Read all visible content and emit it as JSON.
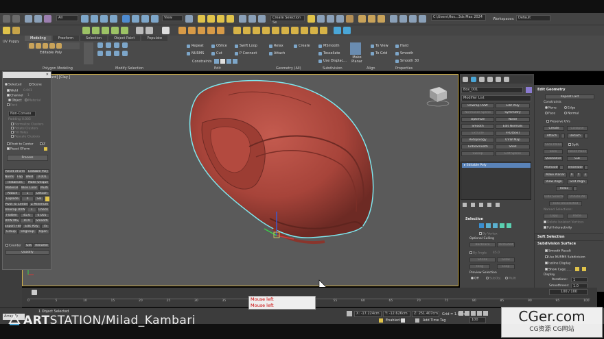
{
  "menubar": {
    "uv_puppy": "UV Puppy"
  },
  "toolbar": {
    "all_filter": "All",
    "view_select": "View",
    "selection_set": "Create Selection Se",
    "workspace_path": "C:\\Users\\Hos...3ds Max 2024",
    "workspace": "Default"
  },
  "ribbon": {
    "tabs": [
      "Modeling",
      "Freeform",
      "Selection",
      "Object Paint",
      "Populate"
    ],
    "active_tab": "Modeling",
    "object_type": "Editable Poly",
    "sections": [
      "Polygon Modeling",
      "Modify Selection",
      "Edit",
      "Geometry (All)",
      "Subdivision",
      "Align",
      "Properties"
    ],
    "edit_buttons": [
      "Repeat",
      "QSlice",
      "Swift Loop",
      "NURMS",
      "Cut",
      "P Connect",
      "Constraints"
    ],
    "geometry_buttons": [
      "Relax",
      "Create",
      "Attach"
    ],
    "subdivision_buttons": [
      "MSmooth",
      "Tessellate",
      "Use Displac..."
    ],
    "align_buttons": [
      "Make Planar",
      "To View",
      "To Grid"
    ],
    "properties_buttons": [
      "Hard",
      "Smooth",
      "Smooth 30"
    ]
  },
  "viewport": {
    "label": "[+] [Standard] [Clay ]"
  },
  "float_panel": {
    "selected": "Selected",
    "scene": "Scene",
    "weld": "Weld",
    "weld_val": "0.001",
    "channel": "Channel",
    "channel_val": "1",
    "object": "Object",
    "material": "Material",
    "pack": "Pack",
    "non_convex": "Non-Convex",
    "padding": "Padding",
    "padding_val": "0.005",
    "normalize": "Normalize Clusters",
    "rotate": "Rotate Clusters",
    "fill_holes": "Fill Holes",
    "rescale": "Rescale Clusters",
    "pivot_center": "Pivot to Center",
    "z_label": "Z",
    "reset_xform": "Reset XForm",
    "process": "Process",
    "rows": [
      [
        "Reset XForm",
        "Editable Poly"
      ],
      [
        "Normal",
        "Flip",
        "Weld",
        "0.001"
      ],
      [
        "Instances",
        "Make Unique"
      ],
      [
        "Material",
        "Wire Color",
        "Multi"
      ],
      [
        "Attach",
        "1",
        "Detach"
      ],
      [
        "Explode",
        "0",
        "Sel"
      ],
      [
        "Pivot To Center",
        "Z Minimum"
      ],
      [
        "Unwrap UVW",
        "1",
        "Check"
      ],
      [
        "Flatten",
        "45.0",
        "0.005"
      ],
      [
        "UVW Map",
        "10.0",
        "Smooth"
      ],
      [
        "Export FBX",
        "Edit Poly",
        "TS"
      ],
      [
        "Group",
        "Ungroup",
        "Open"
      ]
    ],
    "counter": "Counter",
    "get": "Get",
    "rename": "Rename",
    "quadify": "Quadify"
  },
  "command_panel": {
    "object_name": "Box_001",
    "modifier_list": "Modifier List",
    "modifiers": [
      "Unwrap UVW",
      "Edit Poly",
      "Normalize Spline",
      "Symmetry",
      "Optimize",
      "Noise",
      "Smooth",
      "Edit Normals",
      "Extrude",
      "FFD(box)",
      "Retopology",
      "UVW Map",
      "TurboSmooth",
      "Shell",
      "Sweep",
      "Edit Spline"
    ],
    "stack_item": "Editable Poly",
    "selection_header": "Selection",
    "by_vertex": "By Vertex",
    "optional_culling": "Optional Culling",
    "backface": "BackFace",
    "occluded": "Occluded",
    "by_angle": "By Angle",
    "angle_val": "45.0",
    "shrink": "Shrink",
    "grow": "Grow",
    "ring": "Ring",
    "loop": "Loop",
    "preview_selection": "Preview Selection",
    "off": "Off",
    "subobj": "SubObj",
    "multi": "Multi",
    "info": "1 Object Selected"
  },
  "edit_geometry": {
    "header": "Edit Geometry",
    "repeat_last": "Repeat Last",
    "constraints": "Constraints",
    "none": "None",
    "edge": "Edge",
    "face": "Face",
    "normal": "Normal",
    "preserve_uvs": "Preserve UVs",
    "create": "Create",
    "collapse": "Collapse",
    "attach": "Attach",
    "detach": "Detach",
    "slice_plane": "Slice Plane",
    "split": "Split",
    "slice": "Slice",
    "reset_plane": "Reset Plane",
    "quickslice": "QuickSlice",
    "cut": "Cut",
    "msmooth": "MSmooth",
    "tessellate": "Tessellate",
    "make_planar": "Make Planar",
    "x": "X",
    "y": "Y",
    "z": "Z",
    "view_align": "View Align",
    "grid_align": "Grid Align",
    "relax": "Relax",
    "hide_selected": "Hide Selected",
    "unhide_all": "Unhide All",
    "hide_unselected": "Hide Unselected",
    "named_selections": "Named Selections:",
    "copy": "Copy",
    "paste": "Paste",
    "delete_isolated": "Delete Isolated Vertices",
    "full_interactivity": "Full Interactivity",
    "soft_selection": "Soft Selection",
    "subdivision_surface": "Subdivision Surface",
    "smooth_result": "Smooth Result",
    "use_nurms": "Use NURMS Subdivision",
    "isoline": "Isoline Display",
    "show_cage": "Show Cage......",
    "display": "Display",
    "iterations": "Iterations:",
    "iterations_val": "1",
    "smoothness": "Smoothness:",
    "smoothness_val": "1.0"
  },
  "timeline": {
    "frame_counter": "100 / 100",
    "ticks": [
      "0",
      "5",
      "10",
      "15",
      "20",
      "25",
      "30",
      "35",
      "40",
      "45",
      "50",
      "55",
      "60",
      "65",
      "70",
      "75",
      "80",
      "85",
      "90",
      "95",
      "100"
    ]
  },
  "status": {
    "objects": "1 Object Selected",
    "x": "X: -17.224cm",
    "y": "Y: -12.626cm",
    "z": "Z: 251.407cm",
    "grid": "Grid = 1.0cm",
    "enabled": "Enabled:",
    "add_time_tag": "Add Time Tag",
    "frame": "100",
    "script_label": "Array Ty"
  },
  "maxscript_listener": [
    "Mouse left",
    "Mouse left"
  ],
  "watermark": {
    "art": "ART",
    "rest": "STATION/Milad_Kambari"
  },
  "cger": {
    "big": "CGer.com",
    "small": "CG资源 CG网站"
  },
  "colors": {
    "helmet": "#b5473c",
    "outline": "#7ee7ee",
    "viewport": "#5a5a5a",
    "accent": "#d6b44a"
  }
}
